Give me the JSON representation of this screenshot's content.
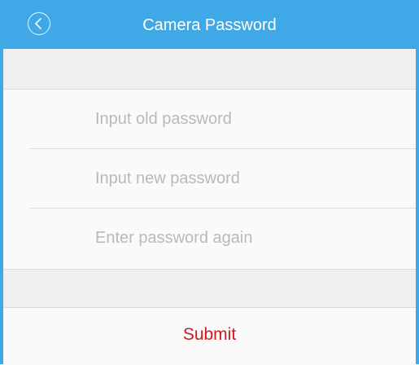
{
  "header": {
    "title": "Camera Password",
    "back_icon": "chevron-left-icon"
  },
  "form": {
    "old_password_placeholder": "Input old password",
    "new_password_placeholder": "Input new password",
    "confirm_password_placeholder": "Enter password again"
  },
  "actions": {
    "submit_label": "Submit"
  },
  "colors": {
    "accent": "#3ea9e6",
    "background": "#efeff2",
    "card": "#fafafa",
    "placeholder": "#b9b9bd",
    "submit": "#cc1b1b"
  }
}
